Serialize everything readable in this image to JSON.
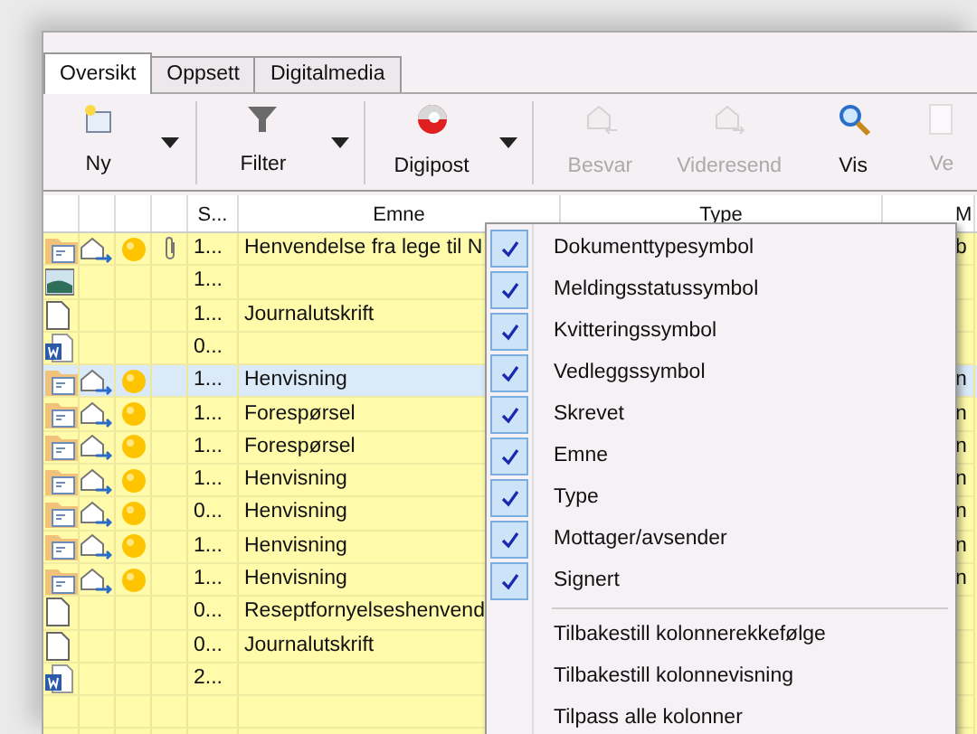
{
  "tabs": [
    {
      "label": "Oversikt",
      "selected": true
    },
    {
      "label": "Oppsett",
      "selected": false
    },
    {
      "label": "Digitalmedia",
      "selected": false
    }
  ],
  "toolbar": [
    {
      "label": "Ny",
      "dropdown": true,
      "disabled": false
    },
    {
      "label": "Filter",
      "dropdown": true,
      "disabled": false
    },
    {
      "label": "Digipost",
      "dropdown": true,
      "disabled": false
    },
    {
      "label": "Besvar",
      "dropdown": false,
      "disabled": true
    },
    {
      "label": "Videresend",
      "dropdown": false,
      "disabled": true
    },
    {
      "label": "Vis",
      "dropdown": false,
      "disabled": false
    },
    {
      "label": "Ve",
      "dropdown": false,
      "disabled": true
    }
  ],
  "table": {
    "columns": [
      "S...",
      "Emne",
      "Type",
      "M"
    ],
    "rows": [
      {
        "kind": "letter",
        "status": true,
        "receipt": true,
        "attachment": true,
        "s": "1...",
        "emne": "Henvendelse fra lege til N",
        "column_3": "b",
        "selected": false
      },
      {
        "kind": "image",
        "status": false,
        "receipt": false,
        "attachment": false,
        "s": "1...",
        "emne": "",
        "column_3": "",
        "selected": false
      },
      {
        "kind": "page",
        "status": false,
        "receipt": false,
        "attachment": false,
        "s": "1...",
        "emne": "Journalutskrift",
        "column_3": "",
        "selected": false
      },
      {
        "kind": "word",
        "status": false,
        "receipt": false,
        "attachment": false,
        "s": "0...",
        "emne": "",
        "column_3": "",
        "selected": false
      },
      {
        "kind": "letter",
        "status": true,
        "receipt": true,
        "attachment": false,
        "s": "1...",
        "emne": "Henvisning",
        "column_3": "n",
        "selected": true
      },
      {
        "kind": "letter",
        "status": true,
        "receipt": true,
        "attachment": false,
        "s": "1...",
        "emne": "Forespørsel",
        "column_3": "n",
        "selected": false
      },
      {
        "kind": "letter",
        "status": true,
        "receipt": true,
        "attachment": false,
        "s": "1...",
        "emne": "Forespørsel",
        "column_3": "n",
        "selected": false
      },
      {
        "kind": "letter",
        "status": true,
        "receipt": true,
        "attachment": false,
        "s": "1...",
        "emne": "Henvisning",
        "column_3": "n",
        "selected": false
      },
      {
        "kind": "letter",
        "status": true,
        "receipt": true,
        "attachment": false,
        "s": "0...",
        "emne": "Henvisning",
        "column_3": "n",
        "selected": false
      },
      {
        "kind": "letter",
        "status": true,
        "receipt": true,
        "attachment": false,
        "s": "1...",
        "emne": "Henvisning",
        "column_3": "n",
        "selected": false
      },
      {
        "kind": "letter",
        "status": true,
        "receipt": true,
        "attachment": false,
        "s": "1...",
        "emne": "Henvisning",
        "column_3": "n",
        "selected": false
      },
      {
        "kind": "page",
        "status": false,
        "receipt": false,
        "attachment": false,
        "s": "0...",
        "emne": "Reseptfornyelseshenvend",
        "column_3": "",
        "selected": false
      },
      {
        "kind": "page",
        "status": false,
        "receipt": false,
        "attachment": false,
        "s": "0...",
        "emne": "Journalutskrift",
        "column_3": "",
        "selected": false
      },
      {
        "kind": "word",
        "status": false,
        "receipt": false,
        "attachment": false,
        "s": "2...",
        "emne": "",
        "column_3": "",
        "selected": false
      }
    ]
  },
  "context_menu": [
    {
      "kind": "check",
      "label": "Dokumenttypesymbol",
      "checked": true
    },
    {
      "kind": "check",
      "label": "Meldingsstatussymbol",
      "checked": true
    },
    {
      "kind": "check",
      "label": "Kvitteringssymbol",
      "checked": true
    },
    {
      "kind": "check",
      "label": "Vedleggssymbol",
      "checked": true
    },
    {
      "kind": "check",
      "label": "Skrevet",
      "checked": true
    },
    {
      "kind": "check",
      "label": "Emne",
      "checked": true
    },
    {
      "kind": "check",
      "label": "Type",
      "checked": true
    },
    {
      "kind": "check",
      "label": "Mottager/avsender",
      "checked": true
    },
    {
      "kind": "check",
      "label": "Signert",
      "checked": true
    },
    {
      "kind": "separator"
    },
    {
      "kind": "action",
      "label": "Tilbakestill kolonnerekkefølge"
    },
    {
      "kind": "action",
      "label": "Tilbakestill kolonnevisning"
    },
    {
      "kind": "action",
      "label": "Tilpass alle kolonner"
    }
  ]
}
